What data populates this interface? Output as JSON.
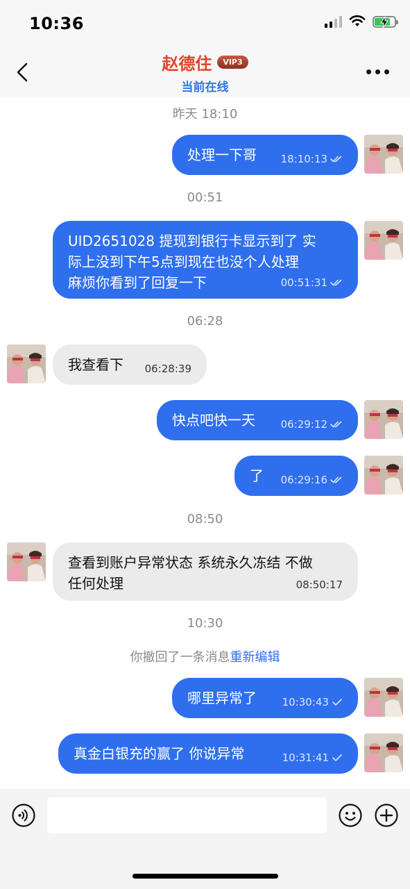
{
  "status_bar": {
    "time": "10:36"
  },
  "header": {
    "name": "赵德住",
    "vip": "VIP3",
    "status": "当前在线"
  },
  "messages": [
    {
      "kind": "timestamp",
      "text": "昨天 18:10"
    },
    {
      "kind": "message",
      "dir": "out",
      "text": "处理一下哥",
      "time": "18:10:13",
      "read": true
    },
    {
      "kind": "timestamp",
      "text": "00:51"
    },
    {
      "kind": "message",
      "dir": "out",
      "lines": [
        "UID2651028 提现到银行卡显示到了 实",
        "际上没到下午5点到现在也没个人处理",
        "麻烦你看到了回复一下"
      ],
      "time": "00:51:31",
      "read": true
    },
    {
      "kind": "timestamp",
      "text": "06:28"
    },
    {
      "kind": "message",
      "dir": "in",
      "text": "我查看下",
      "time": "06:28:39"
    },
    {
      "kind": "message",
      "dir": "out",
      "text": "快点吧快一天",
      "time": "06:29:12",
      "read": true
    },
    {
      "kind": "message",
      "dir": "out",
      "text": "了",
      "time": "06:29:16",
      "read": true
    },
    {
      "kind": "timestamp",
      "text": "08:50"
    },
    {
      "kind": "message",
      "dir": "in",
      "lines": [
        "查看到账户异常状态 系统永久冻结 不做",
        "任何处理"
      ],
      "time": "08:50:17"
    },
    {
      "kind": "timestamp",
      "text": "10:30"
    },
    {
      "kind": "recall",
      "text": "你撤回了一条消息",
      "link": "重新编辑"
    },
    {
      "kind": "message",
      "dir": "out",
      "text": "哪里异常了",
      "time": "10:30:43",
      "read": false
    },
    {
      "kind": "message",
      "dir": "out",
      "text": "真金白银充的赢了 你说异常",
      "time": "10:31:41",
      "read": false
    }
  ],
  "colors": {
    "outgoing_bubble": "#2f6fee",
    "incoming_bubble": "#ebebeb",
    "contact_name": "#e0452c",
    "online_status": "#2f76ea"
  },
  "icons": {
    "back": "chevron-left-icon",
    "more": "more-dots-icon",
    "voice": "voice-icon",
    "emoji": "emoji-icon",
    "plus": "plus-icon"
  }
}
